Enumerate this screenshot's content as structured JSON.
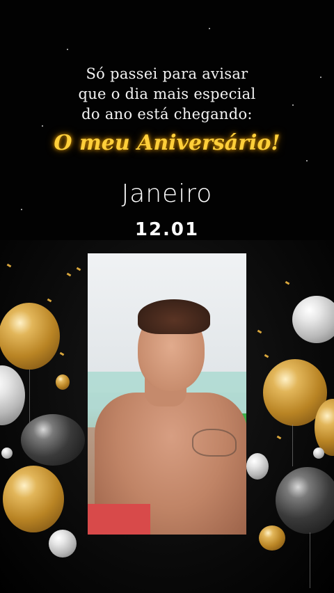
{
  "message": {
    "line1": "Só passei para avisar",
    "line2": "que o dia mais especial",
    "line3": "do ano está chegando:",
    "highlight": "O meu Aniversário!"
  },
  "event": {
    "month": "Janeiro",
    "date": "12.01"
  },
  "colors": {
    "accent_gold": "#ffcf3a",
    "background": "#000000",
    "text": "#f3f3f3"
  },
  "photo": {
    "icon": "person-photo"
  }
}
